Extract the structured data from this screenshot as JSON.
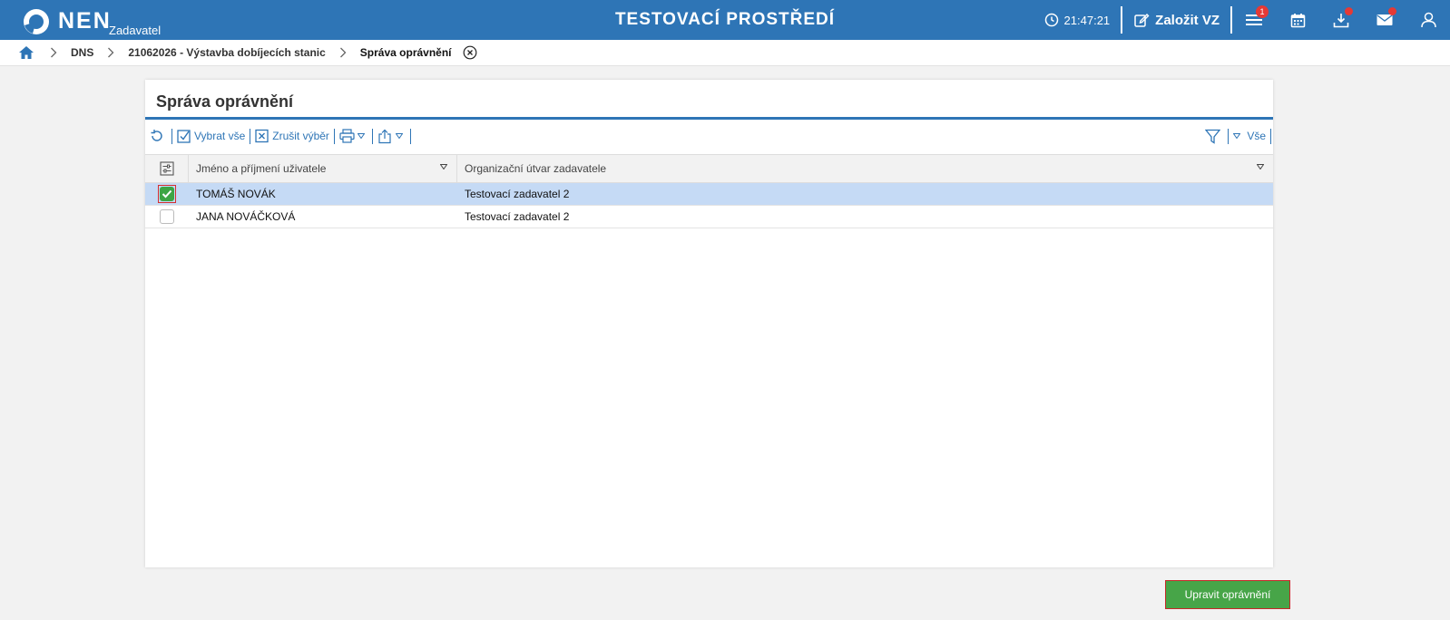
{
  "header": {
    "logo_text": "NEN",
    "logo_sub": "Zadavatel",
    "environment_title": "TESTOVACÍ PROSTŘEDÍ",
    "clock": "21:47:21",
    "create_label": "Založit VZ",
    "menu_badge": "1",
    "brand_color": "#2e75b6",
    "icons": [
      "clock-icon",
      "edit-icon",
      "menu-icon",
      "calendar-icon",
      "download-icon",
      "mail-icon",
      "user-icon"
    ]
  },
  "breadcrumb": {
    "items": [
      "DNS",
      "21062026 - Výstavba dobíjecích stanic"
    ],
    "current": "Správa oprávnění"
  },
  "panel": {
    "title": "Správa oprávnění",
    "toolbar": {
      "select_all": "Vybrat vše",
      "deselect": "Zrušit výběr",
      "filter_scope": "Vše"
    },
    "table": {
      "columns": [
        "Jméno a příjmení uživatele",
        "Organizační útvar zadavatele"
      ],
      "rows": [
        {
          "name": "TOMÁŠ NOVÁK",
          "org": "Testovací zadavatel 2",
          "selected": true
        },
        {
          "name": "JANA NOVÁČKOVÁ",
          "org": "Testovací zadavatel 2",
          "selected": false
        }
      ]
    }
  },
  "actions": {
    "primary_label": "Upravit oprávnění",
    "primary_color": "#47a548"
  }
}
